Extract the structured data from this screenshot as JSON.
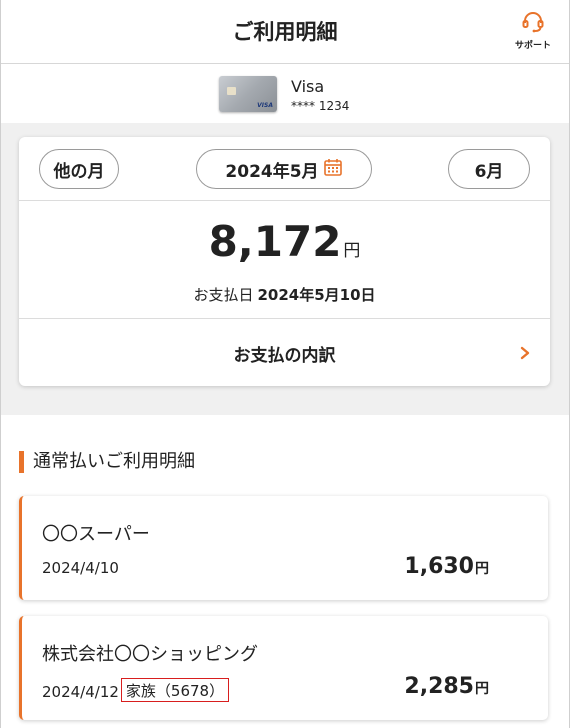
{
  "header": {
    "title": "ご利用明細",
    "support_label": "サポート"
  },
  "card": {
    "name": "Visa",
    "number": "**** 1234",
    "brand_mark": "VISA"
  },
  "summary": {
    "other_month_label": "他の月",
    "current_month_label": "2024年5月",
    "next_month_label": "6月",
    "amount": "8,172",
    "currency": "円",
    "pay_date_label": "お支払日",
    "pay_date": "2024年5月10日",
    "breakdown_label": "お支払の内訳"
  },
  "section": {
    "title": "通常払いご利用明細"
  },
  "transactions": [
    {
      "name": "〇〇スーパー",
      "date": "2024/4/10",
      "family": "",
      "amount": "1,630",
      "currency": "円"
    },
    {
      "name": "株式会社〇〇ショッピング",
      "date": "2024/4/12",
      "family": "家族（5678）",
      "amount": "2,285",
      "currency": "円"
    }
  ],
  "colors": {
    "accent": "#e8732b",
    "highlight_border": "#d81e1e"
  },
  "icons": [
    "headset-icon",
    "calendar-icon",
    "chevron-right-icon"
  ]
}
